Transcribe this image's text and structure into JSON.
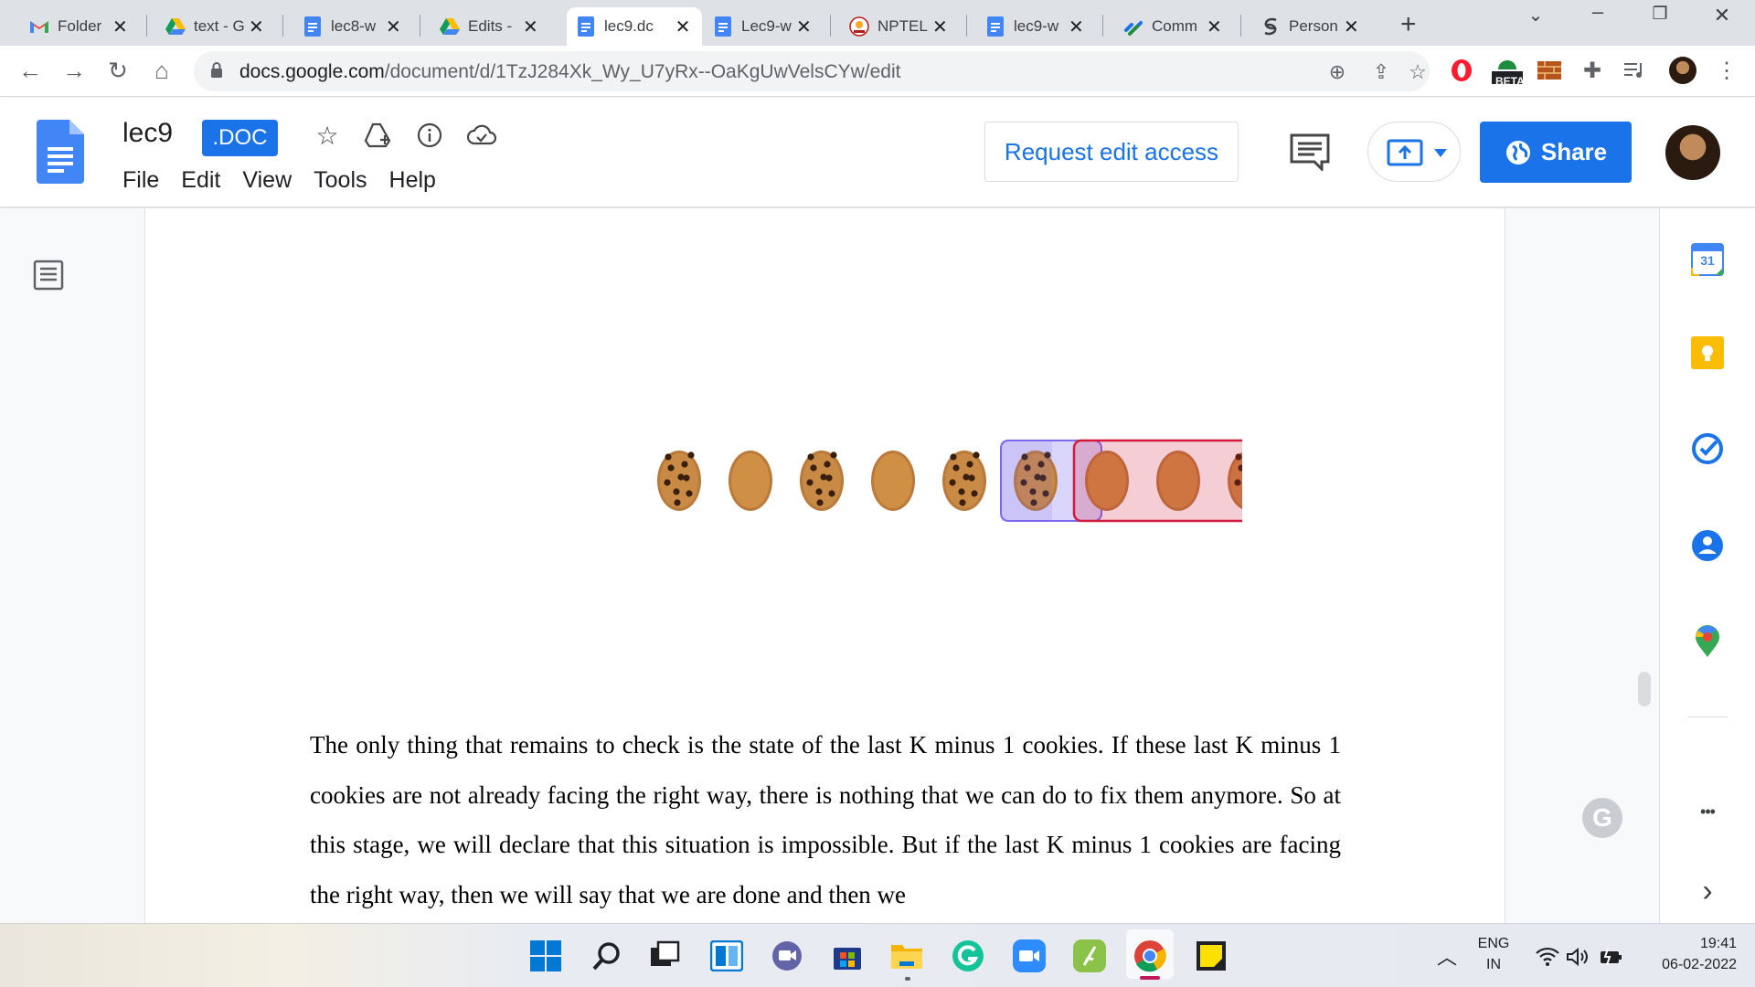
{
  "browser": {
    "tabs": [
      {
        "label": "Folder",
        "icon": "gmail-icon",
        "active": false
      },
      {
        "label": "text - G",
        "icon": "google-drive-icon",
        "active": false
      },
      {
        "label": "lec8-w",
        "icon": "google-docs-icon",
        "active": false
      },
      {
        "label": "Edits -",
        "icon": "google-drive-icon",
        "active": false
      },
      {
        "label": "lec9.dc",
        "icon": "google-docs-icon",
        "active": true
      },
      {
        "label": "Lec9-w",
        "icon": "google-docs-icon",
        "active": false
      },
      {
        "label": "NPTEL",
        "icon": "nptel-icon",
        "active": false
      },
      {
        "label": "lec9-w",
        "icon": "google-docs-icon",
        "active": false
      },
      {
        "label": "Comm",
        "icon": "link-icon",
        "active": false
      },
      {
        "label": "Person",
        "icon": "person-app-icon",
        "active": false
      }
    ],
    "tab_close_glyph": "✕",
    "new_tab_glyph": "+",
    "url_host": "docs.google.com",
    "url_path": "/document/d/1TzJ284Xk_Wy_U7yRx--OaKgUwVelsCYw/edit",
    "beta_label": "BETA"
  },
  "docs": {
    "title": "lec9",
    "badge": ".DOC",
    "menu": [
      "File",
      "Edit",
      "View",
      "Tools",
      "Help"
    ],
    "request_edit_label": "Request edit access",
    "share_label": "Share",
    "accent_color": "#1a73e8"
  },
  "document": {
    "figure": {
      "cookies": [
        {
          "type": "chocolate-chip",
          "highlight": "none"
        },
        {
          "type": "plain",
          "highlight": "none"
        },
        {
          "type": "chocolate-chip",
          "highlight": "none"
        },
        {
          "type": "plain",
          "highlight": "none"
        },
        {
          "type": "chocolate-chip",
          "highlight": "none"
        },
        {
          "type": "chocolate-chip",
          "highlight": "blue"
        },
        {
          "type": "plain",
          "highlight": "red"
        },
        {
          "type": "plain",
          "highlight": "red"
        },
        {
          "type": "chocolate-chip",
          "highlight": "red"
        }
      ],
      "blue_box_color": "#7b68ee",
      "red_box_color": "#d01c3a"
    },
    "body_text": "The only thing that remains to check is the state of the last K minus 1 cookies. If these last K minus 1 cookies are not already facing the right way, there is nothing that we can do to fix them anymore. So at this stage, we will declare that this situation is impossible. But if the last K minus 1 cookies are facing the right way, then we will say that we are done and then we"
  },
  "side_panel": {
    "calendar_day": "31",
    "more_glyph": "•••",
    "expand_glyph": "›"
  },
  "grammarly_glyph": "G",
  "taskbar": {
    "language": "ENG",
    "region": "IN",
    "time": "19:41",
    "date": "06-02-2022"
  }
}
